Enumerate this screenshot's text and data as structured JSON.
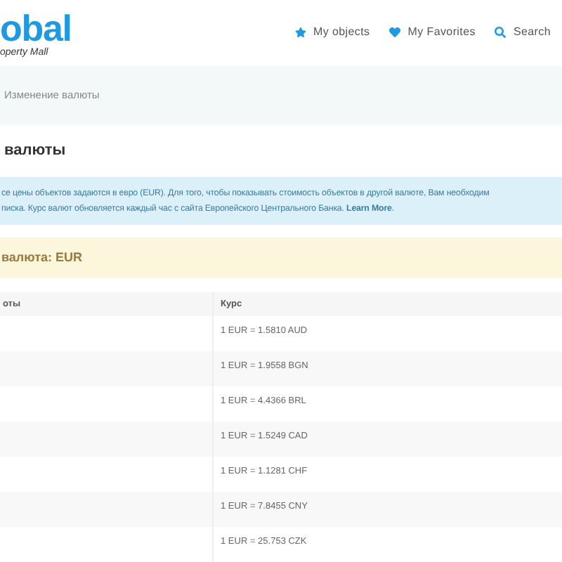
{
  "header": {
    "logo": "obal",
    "logo_subtitle": "operty Mall",
    "nav": [
      {
        "label": "My objects",
        "kind": "star"
      },
      {
        "label": "My Favorites",
        "kind": "heart"
      },
      {
        "label": "Search",
        "kind": "search"
      }
    ]
  },
  "breadcrumb": "Изменение валюты",
  "page_title": "валюты",
  "info_lines": [
    "се цены объектов задаются в евро (EUR). Для того, чтобы показывать стоимость объектов в другой валюте, Вам необходим",
    "писка. Курс валют обновляется каждый час с сайта Европейского Центрального Банка. **Learn More**."
  ],
  "current_currency": "валюта: EUR",
  "table": {
    "columns": [
      "оты",
      "Курс"
    ],
    "rows": [
      [
        "1 EUR = 1.5810 AUD"
      ],
      [
        "1 EUR = 1.9558 BGN"
      ],
      [
        "1 EUR = 4.4366 BRL"
      ],
      [
        "1 EUR = 1.5249 CAD"
      ],
      [
        "1 EUR = 1.1281 CHF"
      ],
      [
        "1 EUR = 7.8455 CNY"
      ],
      [
        "1 EUR = 25.753 CZK"
      ]
    ]
  }
}
